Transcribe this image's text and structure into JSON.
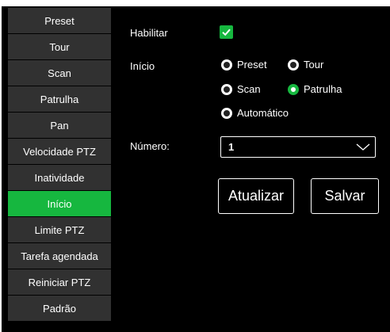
{
  "sidebar": {
    "items": [
      {
        "label": "Preset"
      },
      {
        "label": "Tour"
      },
      {
        "label": "Scan"
      },
      {
        "label": "Patrulha"
      },
      {
        "label": "Pan"
      },
      {
        "label": "Velocidade PTZ"
      },
      {
        "label": "Inatividade"
      },
      {
        "label": "Início"
      },
      {
        "label": "Limite PTZ"
      },
      {
        "label": "Tarefa agendada"
      },
      {
        "label": "Reiniciar PTZ"
      },
      {
        "label": "Padrão"
      }
    ],
    "active_index": 7
  },
  "form": {
    "habilitar_label": "Habilitar",
    "habilitar_checked": true,
    "inicio_label": "Início",
    "inicio_options": [
      {
        "label": "Preset",
        "selected": false
      },
      {
        "label": "Tour",
        "selected": false
      },
      {
        "label": "Scan",
        "selected": false
      },
      {
        "label": "Patrulha",
        "selected": true
      },
      {
        "label": "Automático",
        "selected": false
      }
    ],
    "numero_label": "Número:",
    "numero_value": "1"
  },
  "buttons": {
    "atualizar_label": "Atualizar",
    "salvar_label": "Salvar"
  },
  "colors": {
    "accent": "#16b73f",
    "sidebar_bg": "#313131",
    "panel_bg": "#000000"
  },
  "icons": {
    "checkbox": "checkmark-icon",
    "select": "chevron-down-icon"
  }
}
